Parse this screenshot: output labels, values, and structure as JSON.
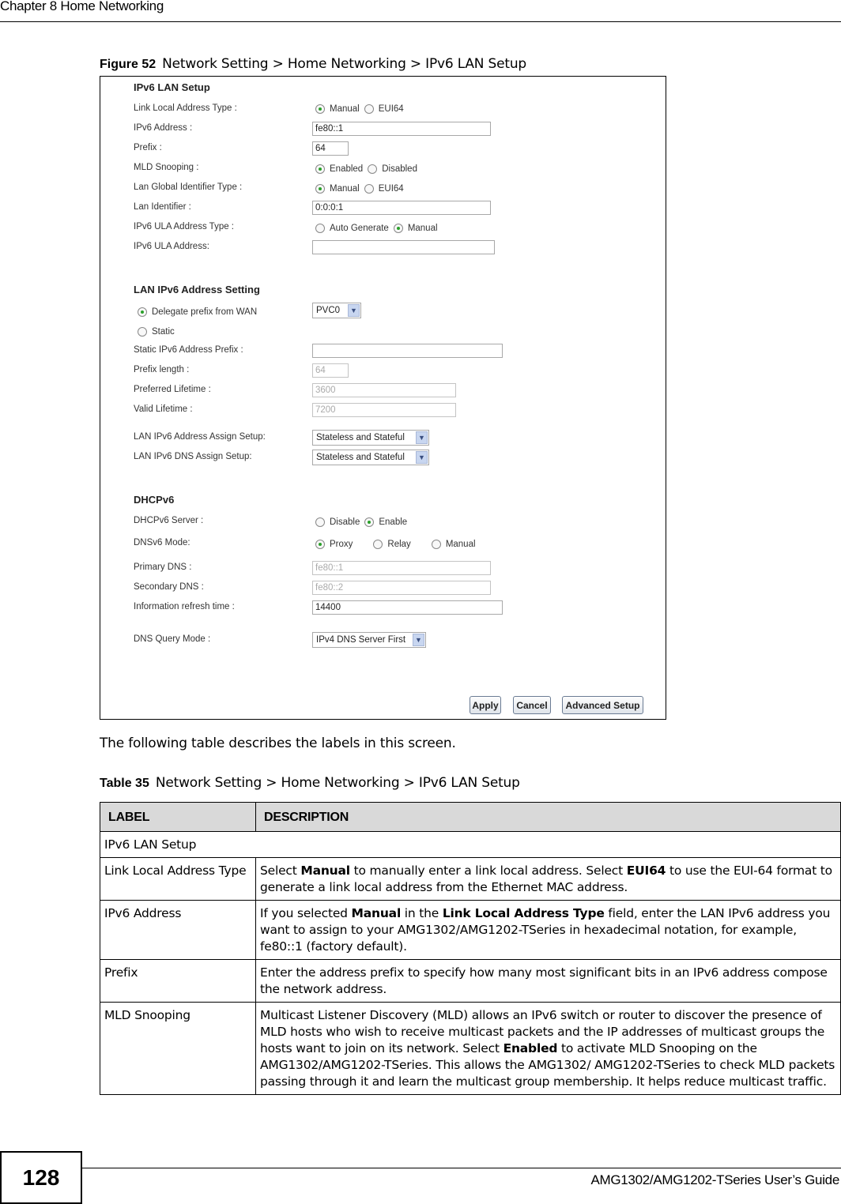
{
  "header": {
    "chapter_title": "Chapter 8 Home Networking"
  },
  "figure_caption": {
    "number": "Figure 52",
    "text": "Network Setting > Home Networking > IPv6 LAN Setup"
  },
  "screen": {
    "ipv6_lan_setup": {
      "title": "IPv6 LAN Setup",
      "link_local_address_type": {
        "label": "Link Local Address Type :",
        "options": [
          "Manual",
          "EUI64"
        ],
        "selected": "Manual"
      },
      "ipv6_address": {
        "label": "IPv6 Address :",
        "value": "fe80::1"
      },
      "prefix": {
        "label": "Prefix :",
        "value": "64"
      },
      "mld_snooping": {
        "label": "MLD Snooping :",
        "options": [
          "Enabled",
          "Disabled"
        ],
        "selected": "Enabled"
      },
      "lan_global_identifier_type": {
        "label": "Lan Global Identifier Type :",
        "options": [
          "Manual",
          "EUI64"
        ],
        "selected": "Manual"
      },
      "lan_identifier": {
        "label": "Lan Identifier :",
        "value": "0:0:0:1"
      },
      "ipv6_ula_address_type": {
        "label": "IPv6 ULA Address Type :",
        "options": [
          "Auto Generate",
          "Manual"
        ],
        "selected": "Manual"
      },
      "ipv6_ula_address": {
        "label": "IPv6 ULA Address:",
        "value": ""
      }
    },
    "lan_ipv6_address_setting": {
      "title": "LAN IPv6 Address Setting",
      "delegate_prefix": {
        "label": "Delegate prefix from WAN",
        "selected": true,
        "wan_select": "PVC0"
      },
      "static": {
        "label": "Static",
        "selected": false
      },
      "static_prefix": {
        "label": "Static IPv6 Address Prefix :",
        "value": ""
      },
      "prefix_length": {
        "label": "Prefix length :",
        "value": "64"
      },
      "preferred_lifetime": {
        "label": "Preferred Lifetime :",
        "value": "3600"
      },
      "valid_lifetime": {
        "label": "Valid Lifetime :",
        "value": "7200"
      },
      "address_assign": {
        "label": "LAN IPv6 Address Assign Setup:",
        "value": "Stateless and Stateful"
      },
      "dns_assign": {
        "label": "LAN IPv6 DNS Assign Setup:",
        "value": "Stateless and Stateful"
      }
    },
    "dhcpv6": {
      "title": "DHCPv6",
      "server": {
        "label": "DHCPv6 Server :",
        "options": [
          "Disable",
          "Enable"
        ],
        "selected": "Enable"
      },
      "dnsv6_mode": {
        "label": "DNSv6 Mode:",
        "options": [
          "Proxy",
          "Relay",
          "Manual"
        ],
        "selected": "Proxy"
      },
      "primary_dns": {
        "label": "Primary DNS :",
        "value": "fe80::1"
      },
      "secondary_dns": {
        "label": "Secondary DNS :",
        "value": "fe80::2"
      },
      "refresh_time": {
        "label": "Information refresh time :",
        "value": "14400"
      },
      "dns_query_mode": {
        "label": "DNS Query Mode :",
        "value": "IPv4 DNS Server First"
      }
    },
    "buttons": {
      "apply": "Apply",
      "cancel": "Cancel",
      "advanced": "Advanced Setup"
    }
  },
  "intro_text": "The following table describes the labels in this screen.",
  "table_caption": {
    "number": "Table 35",
    "text": "Network Setting > Home Networking > IPv6 LAN Setup"
  },
  "table": {
    "headers": [
      "LABEL",
      "DESCRIPTION"
    ],
    "section_row": "IPv6 LAN Setup",
    "rows": [
      {
        "label": "Link Local Address Type",
        "description": [
          {
            "t": "Select "
          },
          {
            "b": "Manual"
          },
          {
            "t": " to manually enter a link local address. Select "
          },
          {
            "b": "EUI64"
          },
          {
            "t": " to use the EUI-64 format to generate a link local address from the Ethernet MAC address."
          }
        ]
      },
      {
        "label": "IPv6 Address",
        "description": [
          {
            "t": "If you selected "
          },
          {
            "b": "Manual"
          },
          {
            "t": " in the "
          },
          {
            "b": "Link Local Address Type"
          },
          {
            "t": " field, enter the LAN IPv6 address you want to assign to your AMG1302/AMG1202-TSeries in hexadecimal notation, for example, fe80::1 (factory default)."
          }
        ]
      },
      {
        "label": "Prefix",
        "description": [
          {
            "t": "Enter the address prefix to specify how many most significant bits in an IPv6 address compose the network address."
          }
        ]
      },
      {
        "label": "MLD Snooping",
        "description": [
          {
            "t": "Multicast Listener Discovery (MLD) allows an IPv6 switch or router to discover the presence of MLD hosts who wish to receive multicast packets and the IP addresses of multicast groups the hosts want to join on its network. Select "
          },
          {
            "b": "Enabled"
          },
          {
            "t": " to activate MLD Snooping on the AMG1302/AMG1202-TSeries. This allows the AMG1302/ AMG1202-TSeries to check MLD packets passing through it and learn the multicast group membership. It helps reduce multicast traffic."
          }
        ]
      }
    ]
  },
  "footer": {
    "page_number": "128",
    "guide_title": "AMG1302/AMG1202-TSeries User’s Guide"
  },
  "colors": {
    "radio_selected": "#2aa02a",
    "table_header_bg": "#d9d9d9",
    "select_arrow_bg": "#c8d6f0"
  }
}
